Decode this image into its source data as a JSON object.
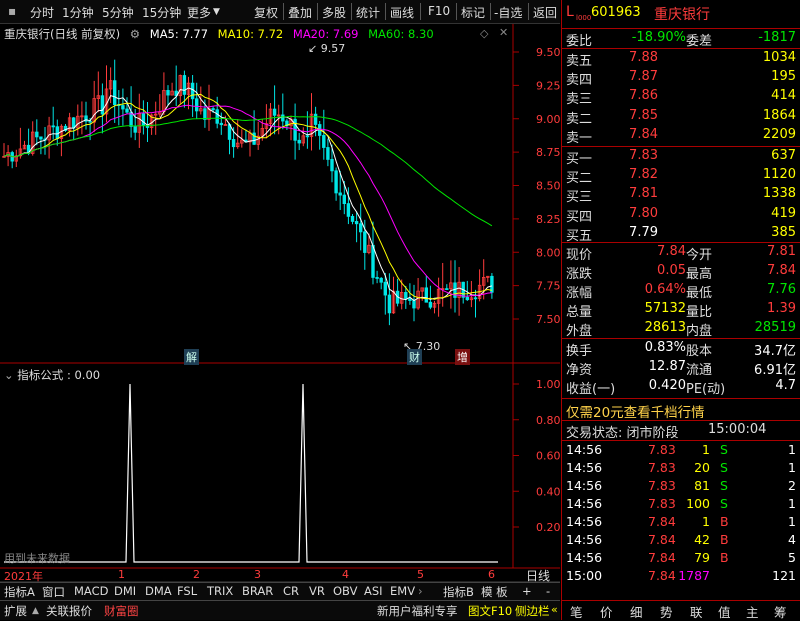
{
  "toolbar": {
    "left": [
      "分时",
      "1分钟",
      "5分钟",
      "15分钟",
      "更多"
    ],
    "right": [
      "复权",
      "叠加",
      "多股",
      "统计",
      "画线",
      "F10",
      "标记",
      "-自选",
      "返回"
    ]
  },
  "chart_header": {
    "name": "重庆银行(日线 前复权)",
    "ma5": "MA5: 7.77",
    "ma10": "MA10: 7.72",
    "ma20": "MA20: 7.69",
    "ma60": "MA60: 8.30"
  },
  "y_axis": [
    "9.50",
    "9.25",
    "9.00",
    "8.75",
    "8.50",
    "8.25",
    "8.00",
    "7.75",
    "7.50"
  ],
  "annotations": {
    "high": "9.57",
    "low": "7.30",
    "marker1": "解",
    "marker2": "财",
    "marker3": "增"
  },
  "indicator": {
    "title": "指标公式 : 0.00",
    "y_axis": [
      "1.00",
      "0.80",
      "0.60",
      "0.40",
      "0.20"
    ],
    "watermark": "用到未来数据"
  },
  "time_axis": {
    "year": "2021年",
    "months": [
      "1",
      "2",
      "3",
      "4",
      "5",
      "6"
    ],
    "period": "日线"
  },
  "tabs1": [
    "指标A",
    "窗口",
    "MACD",
    "DMI",
    "DMA",
    "FSL",
    "TRIX",
    "BRAR",
    "CR",
    "VR",
    "OBV",
    "ASI",
    "EMV",
    "指标B",
    "模 板",
    "+",
    "-"
  ],
  "tabs2": [
    "扩展",
    "关联报价",
    "财富圈"
  ],
  "tabs2_right": [
    "新用户福利专享",
    "图文F10",
    "侧边栏"
  ],
  "quote": {
    "code": "601963",
    "name": "重庆银行",
    "weibi_label": "委比",
    "weibi": "-18.90%",
    "weicha_label": "委差",
    "weicha": "-1817",
    "sell": [
      {
        "label": "卖五",
        "price": "7.88",
        "vol": "1034"
      },
      {
        "label": "卖四",
        "price": "7.87",
        "vol": "195"
      },
      {
        "label": "卖三",
        "price": "7.86",
        "vol": "414"
      },
      {
        "label": "卖二",
        "price": "7.85",
        "vol": "1864"
      },
      {
        "label": "卖一",
        "price": "7.84",
        "vol": "2209"
      }
    ],
    "buy": [
      {
        "label": "买一",
        "price": "7.83",
        "vol": "637"
      },
      {
        "label": "买二",
        "price": "7.82",
        "vol": "1120"
      },
      {
        "label": "买三",
        "price": "7.81",
        "vol": "1338"
      },
      {
        "label": "买四",
        "price": "7.80",
        "vol": "419"
      },
      {
        "label": "买五",
        "price": "7.79",
        "vol": "385"
      }
    ],
    "stats": [
      [
        "现价",
        "7.84",
        "今开",
        "7.81"
      ],
      [
        "涨跌",
        "0.05",
        "最高",
        "7.84"
      ],
      [
        "涨幅",
        "0.64%",
        "最低",
        "7.76"
      ],
      [
        "总量",
        "57132",
        "量比",
        "1.39"
      ],
      [
        "外盘",
        "28613",
        "内盘",
        "28519"
      ]
    ],
    "fund": [
      [
        "换手",
        "0.83%",
        "股本",
        "34.7亿"
      ],
      [
        "净资",
        "12.87",
        "流通",
        "6.91亿"
      ],
      [
        "收益(一)",
        "0.420",
        "PE(动)",
        "4.7"
      ]
    ],
    "promo": "仅需20元查看千档行情",
    "status_label": "交易状态: 闭市阶段",
    "status_time": "15:00:04",
    "trades": [
      [
        "14:56",
        "7.83",
        "1",
        "S",
        "1"
      ],
      [
        "14:56",
        "7.83",
        "20",
        "S",
        "1"
      ],
      [
        "14:56",
        "7.83",
        "81",
        "S",
        "2"
      ],
      [
        "14:56",
        "7.83",
        "100",
        "S",
        "1"
      ],
      [
        "14:56",
        "7.84",
        "1",
        "B",
        "1"
      ],
      [
        "14:56",
        "7.84",
        "42",
        "B",
        "4"
      ],
      [
        "14:56",
        "7.84",
        "79",
        "B",
        "5"
      ],
      [
        "15:00",
        "7.84",
        "1787",
        "",
        "121"
      ]
    ],
    "bottom_nav": [
      "笔",
      "价",
      "细",
      "势",
      "联",
      "值",
      "主",
      "筹"
    ]
  },
  "colors": {
    "up": "#ff3c3c",
    "down": "#00e6e6",
    "ma5": "#ffffff",
    "ma10": "#ffff00",
    "ma20": "#ff00ff",
    "ma60": "#00e600",
    "frame": "#aa0000"
  }
}
